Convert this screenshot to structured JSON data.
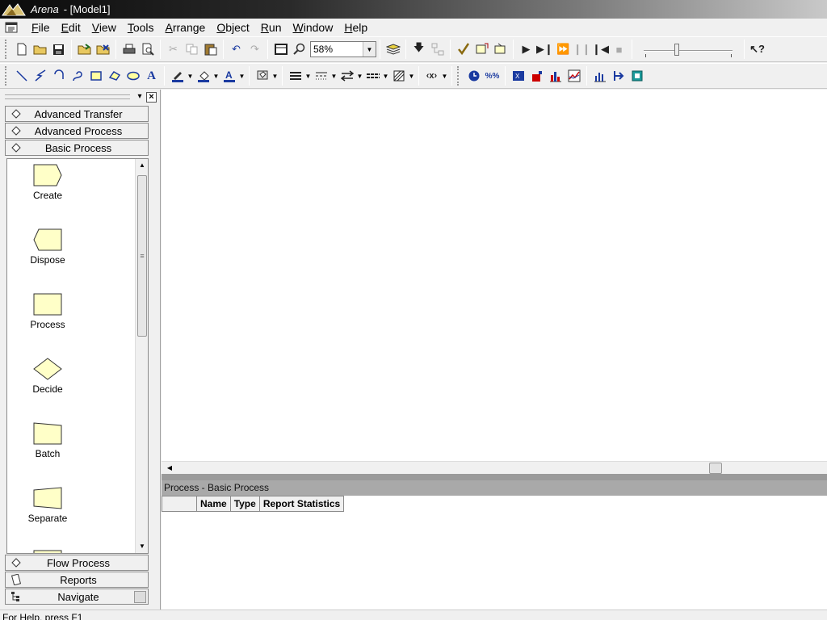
{
  "titlebar": {
    "app_name": "Arena",
    "document": "- [Model1]"
  },
  "menu": [
    {
      "acc": "F",
      "rest": "ile"
    },
    {
      "acc": "E",
      "rest": "dit"
    },
    {
      "acc": "V",
      "rest": "iew"
    },
    {
      "acc": "T",
      "rest": "ools"
    },
    {
      "acc": "A",
      "rest": "rrange"
    },
    {
      "acc": "O",
      "rest": "bject"
    },
    {
      "acc": "R",
      "rest": "un"
    },
    {
      "acc": "W",
      "rest": "indow"
    },
    {
      "acc": "H",
      "rest": "elp"
    }
  ],
  "toolbar": {
    "zoom_value": "58%"
  },
  "project_bar": {
    "panels_top": [
      "Advanced Transfer",
      "Advanced Process",
      "Basic Process"
    ],
    "modules": [
      "Create",
      "Dispose",
      "Process",
      "Decide",
      "Batch",
      "Separate"
    ],
    "panels_bottom": [
      "Flow Process",
      "Reports",
      "Navigate"
    ]
  },
  "spreadsheet": {
    "title": "Process - Basic Process",
    "columns": [
      "Name",
      "Type",
      "Report Statistics"
    ]
  },
  "statusbar": {
    "text": "For Help, press F1"
  },
  "colors": {
    "module_fill": "#ffffc8",
    "titlebar_dark": "#0b0b0b",
    "sheet_title_bg": "#a9a9a9"
  }
}
